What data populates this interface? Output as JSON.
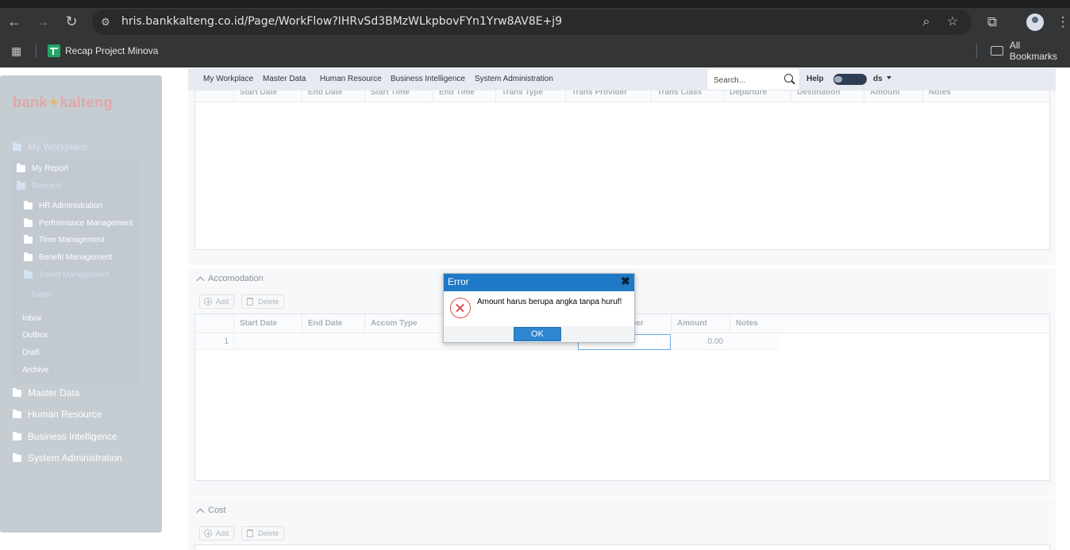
{
  "browser": {
    "url": "hris.bankkalteng.co.id/Page/WorkFlow?IHRvSd3BMzWLkpbovFYn1Yrw8AV8E+j9",
    "bookmark": "Recap Project Minova",
    "all_bookmarks": "All Bookmarks"
  },
  "sidebar": {
    "logo_left": "bank",
    "logo_right": "kalteng",
    "my_workplace": "My Workplace",
    "my_report": "My Report",
    "request": "Request",
    "hr_administration": "HR Administration",
    "performance_management": "Performance Management",
    "time_management": "Time Management",
    "benefit_management": "Benefit Management",
    "travel_management": "Travel Management",
    "travel": "Travel",
    "inbox": "Inbox",
    "outbox": "Outbox",
    "draft": "Draft",
    "archive": "Archive",
    "master_data": "Master Data",
    "human_resource": "Human Resource",
    "business_intelligence": "Business Intelligence",
    "system_administration": "System Administration"
  },
  "appnav": {
    "items": [
      "My Workplace",
      "Master Data",
      "Human Resource",
      "Business Intelligence",
      "System Administration"
    ],
    "search_placeholder": "Search...",
    "help": "Help",
    "user": "ds"
  },
  "transport": {
    "columns": [
      "Start Date",
      "End Date",
      "Start Time",
      "End Time",
      "Trans Type",
      "Trans Provider",
      "Trans Class",
      "Departure",
      "Destination",
      "Amount",
      "Notes"
    ]
  },
  "accomodation": {
    "title": "Accomodation",
    "add": "Add",
    "delete": "Delete",
    "columns": [
      "Start Date",
      "End Date",
      "Accom Type",
      "Number",
      "Amount",
      "Notes"
    ],
    "row_number": "1",
    "row_amount": "0.00"
  },
  "cost": {
    "title": "Cost",
    "add": "Add",
    "delete": "Delete"
  },
  "dialog": {
    "title": "Error",
    "message": "Amount harus berupa angka tanpa huruf!",
    "ok": "OK"
  }
}
